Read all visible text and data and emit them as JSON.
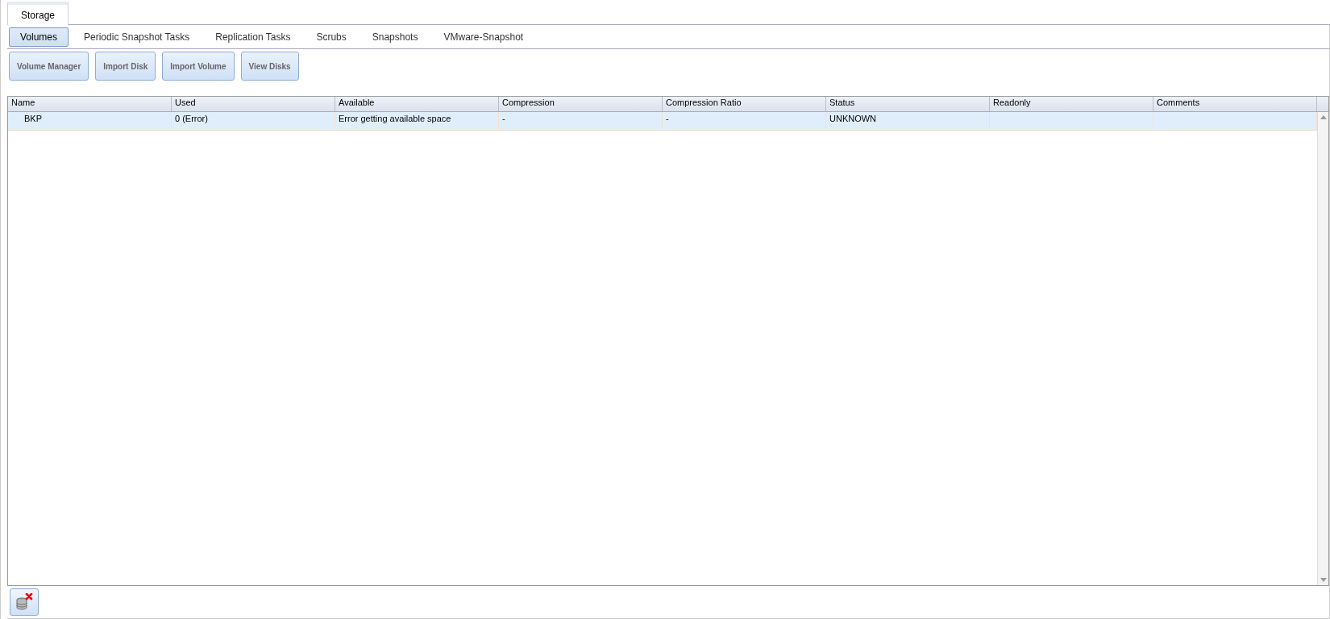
{
  "main_tabs": [
    {
      "label": "Storage",
      "selected": true
    }
  ],
  "sub_tabs": [
    {
      "label": "Volumes",
      "selected": true
    },
    {
      "label": "Periodic Snapshot Tasks",
      "selected": false
    },
    {
      "label": "Replication Tasks",
      "selected": false
    },
    {
      "label": "Scrubs",
      "selected": false
    },
    {
      "label": "Snapshots",
      "selected": false
    },
    {
      "label": "VMware-Snapshot",
      "selected": false
    }
  ],
  "buttons": [
    "Volume Manager",
    "Import Disk",
    "Import Volume",
    "View Disks"
  ],
  "table": {
    "columns": [
      "Name",
      "Used",
      "Available",
      "Compression",
      "Compression Ratio",
      "Status",
      "Readonly",
      "Comments"
    ],
    "rows": [
      {
        "cells": [
          "BKP",
          "0 (Error)",
          "Error getting available space",
          "-",
          "-",
          "UNKNOWN",
          "",
          ""
        ],
        "selected": true
      }
    ]
  }
}
